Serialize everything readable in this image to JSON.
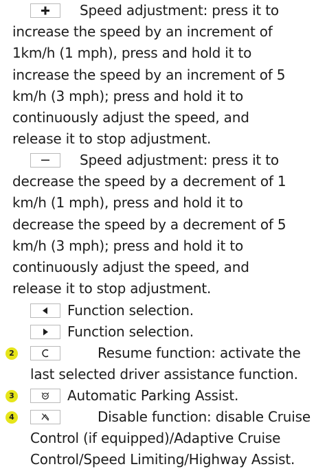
{
  "entries": [
    {
      "badge": "",
      "icon": "plus-icon",
      "icon_glyph": "+",
      "text": "Speed adjustment: press it to increase the speed by an increment of 1km/h (1 mph), press and hold it to increase the speed by an increment of 5 km/h (3 mph); press and hold it to continuously adjust the speed, and release it to stop adjustment."
    },
    {
      "badge": "",
      "icon": "minus-icon",
      "icon_glyph": "−",
      "text": "Speed adjustment: press it to decrease the speed by a decrement of 1 km/h (1 mph), press and hold it to decrease the speed by a decrement of 5 km/h (3 mph); press and hold it to continuously adjust the speed, and release it to stop adjustment."
    },
    {
      "badge": "",
      "icon": "arrow-left-icon",
      "icon_glyph": "◀",
      "text": "Function selection."
    },
    {
      "badge": "",
      "icon": "arrow-right-icon",
      "icon_glyph": "▶",
      "text": "Function selection."
    },
    {
      "badge": "2",
      "icon": "resume-icon",
      "icon_glyph": "C",
      "text": "Resume function: activate the last selected driver assistance function."
    },
    {
      "badge": "3",
      "icon": "parking-assist-icon",
      "icon_glyph": "⚙",
      "text": "Automatic Parking Assist."
    },
    {
      "badge": "4",
      "icon": "disable-function-icon",
      "icon_glyph": "⊘",
      "text": "Disable function: disable Cruise Control (if equipped)/Adaptive Cruise Control/Speed Limiting/Highway Assist."
    }
  ],
  "colors": {
    "badge_bg": "#e6e51a",
    "text": "#1c1c1c",
    "key_border": "#b9b9b9"
  }
}
